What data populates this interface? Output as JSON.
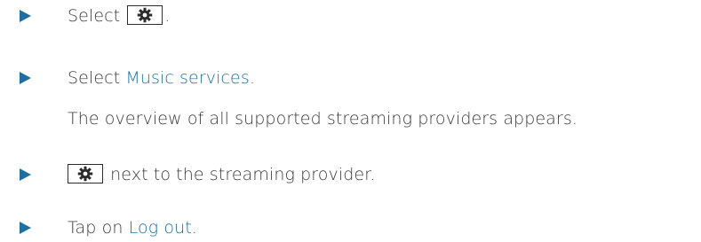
{
  "steps": [
    {
      "before": "Select ",
      "icon": "gear-icon",
      "after": "."
    },
    {
      "before": "Select ",
      "link": "Music services",
      "after": ".",
      "note": "The overview of all supported streaming providers appears."
    },
    {
      "icon": "gear-icon",
      "after": " next to the streaming provider."
    },
    {
      "before": "Tap on ",
      "link": "Log out",
      "after": "."
    }
  ],
  "colors": {
    "accent": "#1f6fa0",
    "text": "#3a3a3a"
  }
}
